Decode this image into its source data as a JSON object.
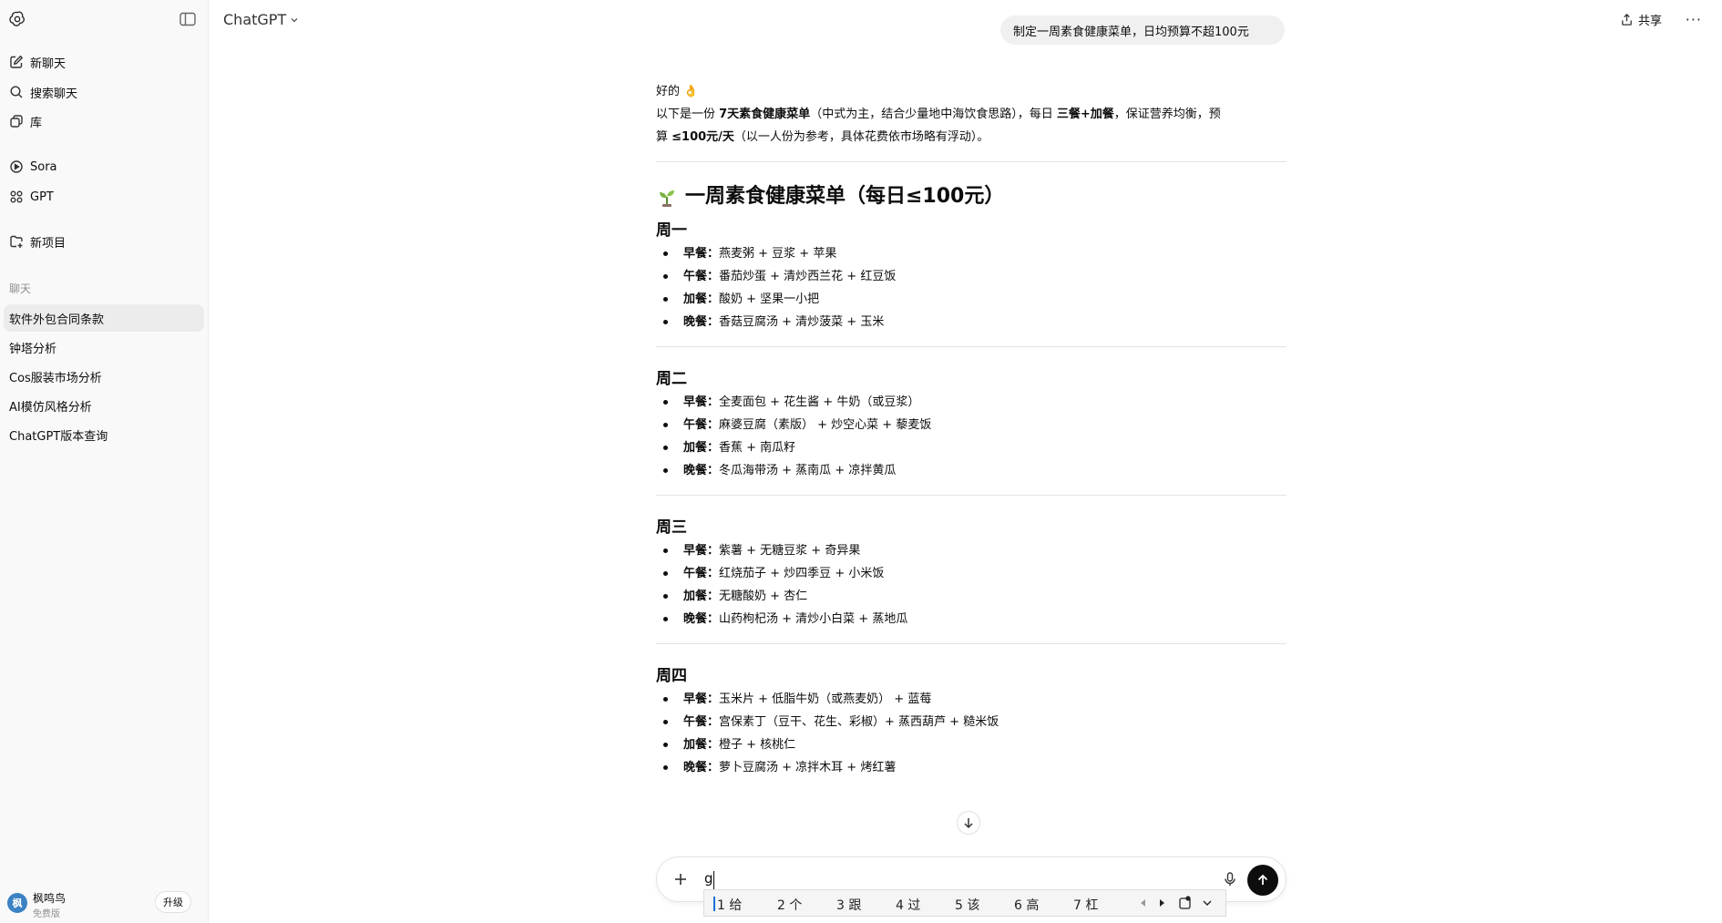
{
  "sidebar": {
    "nav": [
      {
        "label": "新聊天",
        "icon": "edit-icon"
      },
      {
        "label": "搜索聊天",
        "icon": "search-icon"
      },
      {
        "label": "库",
        "icon": "library-icon"
      },
      {
        "label": "Sora",
        "icon": "play-icon"
      },
      {
        "label": "GPT",
        "icon": "grid-icon"
      },
      {
        "label": "新项目",
        "icon": "folder-plus-icon"
      }
    ],
    "section_title": "聊天",
    "chats": [
      "软件外包合同条款",
      "钟塔分析",
      "Cos服装市场分析",
      "AI模仿风格分析",
      "ChatGPT版本查询"
    ],
    "user": {
      "avatar_text": "枫",
      "name": "枫鸣鸟",
      "plan": "免费版",
      "upgrade_label": "升级"
    }
  },
  "header": {
    "model_name": "ChatGPT",
    "share_label": "共享",
    "more_label": "···"
  },
  "conversation": {
    "user_message": "制定一周素食健康菜单，日均预算不超100元",
    "intro_line1": "好的 👌",
    "intro_line2_parts": [
      "以下是一份 ",
      "7天素食健康菜单",
      "（中式为主，结合少量地中海饮食思路），每日 ",
      "三餐+加餐",
      "，保证营养均衡，预"
    ],
    "intro_line3_parts": [
      "算 ",
      "≤100元/天",
      "（以一人份为参考，具体花费依市场略有浮动）。"
    ],
    "menu_title": "一周素食健康菜单（每日≤100元）",
    "days": [
      {
        "name": "周一",
        "meals": [
          {
            "label": "早餐：",
            "items": "燕麦粥 + 豆浆 + 苹果"
          },
          {
            "label": "午餐：",
            "items": "番茄炒蛋 + 清炒西兰花 + 红豆饭"
          },
          {
            "label": "加餐：",
            "items": "酸奶 + 坚果一小把"
          },
          {
            "label": "晚餐：",
            "items": "香菇豆腐汤 + 清炒菠菜 + 玉米"
          }
        ]
      },
      {
        "name": "周二",
        "meals": [
          {
            "label": "早餐：",
            "items": "全麦面包 + 花生酱 + 牛奶（或豆浆）"
          },
          {
            "label": "午餐：",
            "items": "麻婆豆腐（素版） + 炒空心菜 + 藜麦饭"
          },
          {
            "label": "加餐：",
            "items": "香蕉 + 南瓜籽"
          },
          {
            "label": "晚餐：",
            "items": "冬瓜海带汤 + 蒸南瓜 + 凉拌黄瓜"
          }
        ]
      },
      {
        "name": "周三",
        "meals": [
          {
            "label": "早餐：",
            "items": "紫薯 + 无糖豆浆 + 奇异果"
          },
          {
            "label": "午餐：",
            "items": "红烧茄子 + 炒四季豆 + 小米饭"
          },
          {
            "label": "加餐：",
            "items": "无糖酸奶 + 杏仁"
          },
          {
            "label": "晚餐：",
            "items": "山药枸杞汤 + 清炒小白菜 + 蒸地瓜"
          }
        ]
      },
      {
        "name": "周四",
        "meals": [
          {
            "label": "早餐：",
            "items": "玉米片 + 低脂牛奶（或燕麦奶） + 蓝莓"
          },
          {
            "label": "午餐：",
            "items": "宫保素丁（豆干、花生、彩椒）+ 蒸西葫芦 + 糙米饭"
          },
          {
            "label": "加餐：",
            "items": "橙子 + 核桃仁"
          },
          {
            "label": "晚餐：",
            "items": "萝卜豆腐汤 + 凉拌木耳 + 烤红薯"
          }
        ]
      }
    ]
  },
  "composer": {
    "typed_text": "g"
  },
  "ime": {
    "candidates": [
      "1 给",
      "2 个",
      "3 跟",
      "4 过",
      "5 该",
      "6 高",
      "7 杠"
    ]
  },
  "colors": {
    "sidebar_bg": "#f9f9f9",
    "active_chat_bg": "#ececec",
    "bubble_bg": "#f0f0f0",
    "send_bg": "#0d0d0d",
    "ime_highlight": "#1a6ed8"
  }
}
